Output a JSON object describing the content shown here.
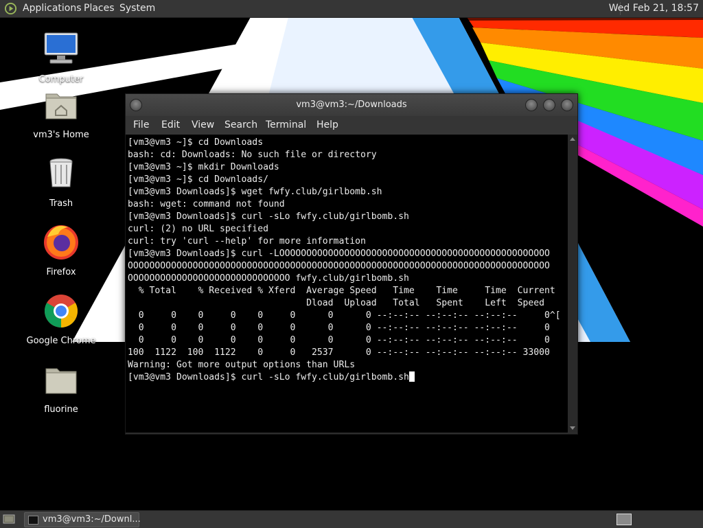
{
  "top_panel": {
    "menus": [
      "Applications",
      "Places",
      "System"
    ],
    "clock": "Wed Feb 21, 18:57"
  },
  "desktop_icons": [
    {
      "label": "Computer",
      "icon": "computer-icon"
    },
    {
      "label": "vm3's Home",
      "icon": "home-folder-icon"
    },
    {
      "label": "Trash",
      "icon": "trash-icon"
    },
    {
      "label": "Firefox",
      "icon": "firefox-icon"
    },
    {
      "label": "Google Chrome",
      "icon": "chrome-icon"
    },
    {
      "label": "fluorine",
      "icon": "folder-icon"
    }
  ],
  "terminal": {
    "title": "vm3@vm3:~/Downloads",
    "menu": [
      "File",
      "Edit",
      "View",
      "Search",
      "Terminal",
      "Help"
    ],
    "lines": [
      "[vm3@vm3 ~]$ cd Downloads",
      "bash: cd: Downloads: No such file or directory",
      "[vm3@vm3 ~]$ mkdir Downloads",
      "[vm3@vm3 ~]$ cd Downloads/",
      "[vm3@vm3 Downloads]$ wget fwfy.club/girlbomb.sh",
      "bash: wget: command not found",
      "[vm3@vm3 Downloads]$ curl -sLo fwfy.club/girlbomb.sh",
      "curl: (2) no URL specified",
      "curl: try 'curl --help' for more information",
      "[vm3@vm3 Downloads]$ curl -LOOOOOOOOOOOOOOOOOOOOOOOOOOOOOOOOOOOOOOOOOOOOOOOOOO",
      "OOOOOOOOOOOOOOOOOOOOOOOOOOOOOOOOOOOOOOOOOOOOOOOOOOOOOOOOOOOOOOOOOOOOOOOOOOOOOO",
      "OOOOOOOOOOOOOOOOOOOOOOOOOOOOOO fwfy.club/girlbomb.sh",
      "  % Total    % Received % Xferd  Average Speed   Time    Time     Time  Current",
      "                                 Dload  Upload   Total   Spent    Left  Speed",
      "  0     0    0     0    0     0      0      0 --:--:-- --:--:-- --:--:--     0^[",
      "  0     0    0     0    0     0      0      0 --:--:-- --:--:-- --:--:--     0",
      "  0     0    0     0    0     0      0      0 --:--:-- --:--:-- --:--:--     0",
      "100  1122  100  1122    0     0   2537      0 --:--:-- --:--:-- --:--:-- 33000",
      "Warning: Got more output options than URLs"
    ],
    "prompt_line": "[vm3@vm3 Downloads]$ curl -sLo fwfy.club/girlbomb.sh"
  },
  "bottom_panel": {
    "task_label": "vm3@vm3:~/Downl..."
  }
}
